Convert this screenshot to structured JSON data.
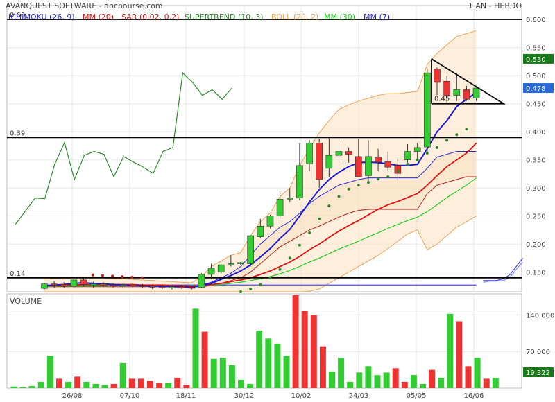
{
  "header": {
    "title": "AVANQUEST SOFTWARE - abcbourse.com",
    "period": "1 AN - HEBDO"
  },
  "legend": [
    {
      "label": "ICHIMOKU (26, 9)",
      "color": "#1f1fd0"
    },
    {
      "label": "MM (20)",
      "color": "#e01010"
    },
    {
      "label": "SAR (0.02, 0.2)",
      "color": "#c02020"
    },
    {
      "label": "SUPERTREND (10, 3)",
      "color": "#2a8a2a"
    },
    {
      "label": "BOLL (20, 2)",
      "color": "#f0a050"
    },
    {
      "label": "MM (30)",
      "color": "#22cc22"
    },
    {
      "label": "MM (7)",
      "color": "#2020e0"
    }
  ],
  "colors": {
    "up": "#33cc33",
    "down": "#ee3333",
    "ichimoku": "#1f1fd0",
    "mm20": "#e01010",
    "sar": "#c02020",
    "supertrend": "#2a8a2a",
    "boll": "#f0a050",
    "mm30": "#22cc22",
    "mm7": "#1818d8"
  },
  "chart_data": [
    {
      "type": "candlestick",
      "name": "price",
      "x_ticks": [
        "26/08",
        "07/10",
        "18/11",
        "30/12",
        "10/02",
        "24/03",
        "05/05",
        "16/06"
      ],
      "y_ticks": [
        "0.600",
        "0.550",
        "0.500",
        "0.450",
        "0.400",
        "0.350",
        "0.300",
        "0.250",
        "0.200",
        "0.150"
      ],
      "ylim": [
        0.115,
        0.625
      ],
      "price_tags": [
        {
          "value": 0.53,
          "label": "0.530",
          "bg": "#1a7a1a"
        },
        {
          "value": 0.478,
          "label": "0.478",
          "bg": "#2a6ad8"
        }
      ],
      "levels": [
        {
          "value": 0.6,
          "label": "0.60"
        },
        {
          "value": 0.39,
          "label": "0.39"
        },
        {
          "value": 0.14,
          "label": "0.14"
        }
      ],
      "triangle": {
        "label": "0.45",
        "apex": 0.53,
        "base": 0.45
      },
      "candles": [
        {
          "o": 0.121,
          "h": 0.131,
          "l": 0.119,
          "c": 0.129
        },
        {
          "o": 0.129,
          "h": 0.134,
          "l": 0.121,
          "c": 0.128
        },
        {
          "o": 0.128,
          "h": 0.132,
          "l": 0.122,
          "c": 0.125
        },
        {
          "o": 0.125,
          "h": 0.139,
          "l": 0.122,
          "c": 0.136
        },
        {
          "o": 0.136,
          "h": 0.139,
          "l": 0.125,
          "c": 0.128
        },
        {
          "o": 0.128,
          "h": 0.133,
          "l": 0.122,
          "c": 0.129
        },
        {
          "o": 0.129,
          "h": 0.132,
          "l": 0.124,
          "c": 0.127
        },
        {
          "o": 0.127,
          "h": 0.13,
          "l": 0.122,
          "c": 0.126
        },
        {
          "o": 0.126,
          "h": 0.129,
          "l": 0.121,
          "c": 0.127
        },
        {
          "o": 0.127,
          "h": 0.13,
          "l": 0.122,
          "c": 0.126
        },
        {
          "o": 0.126,
          "h": 0.129,
          "l": 0.121,
          "c": 0.125
        },
        {
          "o": 0.125,
          "h": 0.128,
          "l": 0.12,
          "c": 0.124
        },
        {
          "o": 0.124,
          "h": 0.128,
          "l": 0.12,
          "c": 0.123
        },
        {
          "o": 0.123,
          "h": 0.127,
          "l": 0.119,
          "c": 0.124
        },
        {
          "o": 0.124,
          "h": 0.127,
          "l": 0.12,
          "c": 0.123
        },
        {
          "o": 0.123,
          "h": 0.126,
          "l": 0.119,
          "c": 0.122
        },
        {
          "o": 0.123,
          "h": 0.148,
          "l": 0.121,
          "c": 0.146
        },
        {
          "o": 0.146,
          "h": 0.165,
          "l": 0.14,
          "c": 0.157
        },
        {
          "o": 0.15,
          "h": 0.165,
          "l": 0.148,
          "c": 0.163
        },
        {
          "o": 0.163,
          "h": 0.18,
          "l": 0.16,
          "c": 0.165
        },
        {
          "o": 0.165,
          "h": 0.168,
          "l": 0.163,
          "c": 0.167
        },
        {
          "o": 0.165,
          "h": 0.215,
          "l": 0.16,
          "c": 0.215
        },
        {
          "o": 0.213,
          "h": 0.245,
          "l": 0.21,
          "c": 0.232
        },
        {
          "o": 0.232,
          "h": 0.252,
          "l": 0.228,
          "c": 0.25
        },
        {
          "o": 0.25,
          "h": 0.295,
          "l": 0.245,
          "c": 0.28
        },
        {
          "o": 0.28,
          "h": 0.3,
          "l": 0.275,
          "c": 0.282
        },
        {
          "o": 0.282,
          "h": 0.38,
          "l": 0.278,
          "c": 0.34
        },
        {
          "o": 0.343,
          "h": 0.385,
          "l": 0.33,
          "c": 0.38
        },
        {
          "o": 0.38,
          "h": 0.388,
          "l": 0.3,
          "c": 0.315
        },
        {
          "o": 0.335,
          "h": 0.39,
          "l": 0.32,
          "c": 0.358
        },
        {
          "o": 0.358,
          "h": 0.38,
          "l": 0.345,
          "c": 0.365
        },
        {
          "o": 0.365,
          "h": 0.372,
          "l": 0.345,
          "c": 0.36
        },
        {
          "o": 0.356,
          "h": 0.388,
          "l": 0.33,
          "c": 0.32
        },
        {
          "o": 0.322,
          "h": 0.385,
          "l": 0.31,
          "c": 0.356
        },
        {
          "o": 0.355,
          "h": 0.37,
          "l": 0.33,
          "c": 0.346
        },
        {
          "o": 0.347,
          "h": 0.365,
          "l": 0.33,
          "c": 0.337
        },
        {
          "o": 0.34,
          "h": 0.355,
          "l": 0.312,
          "c": 0.326
        },
        {
          "o": 0.35,
          "h": 0.378,
          "l": 0.345,
          "c": 0.365
        },
        {
          "o": 0.365,
          "h": 0.38,
          "l": 0.352,
          "c": 0.372
        },
        {
          "o": 0.373,
          "h": 0.512,
          "l": 0.36,
          "c": 0.505
        },
        {
          "o": 0.512,
          "h": 0.515,
          "l": 0.465,
          "c": 0.488
        },
        {
          "o": 0.49,
          "h": 0.5,
          "l": 0.452,
          "c": 0.465
        },
        {
          "o": 0.465,
          "h": 0.505,
          "l": 0.455,
          "c": 0.475
        },
        {
          "o": 0.475,
          "h": 0.482,
          "l": 0.455,
          "c": 0.458
        },
        {
          "o": 0.46,
          "h": 0.482,
          "l": 0.455,
          "c": 0.478
        }
      ],
      "boll_upper": [
        0.138,
        0.139,
        0.139,
        0.14,
        0.141,
        0.141,
        0.14,
        0.139,
        0.138,
        0.137,
        0.136,
        0.135,
        0.134,
        0.133,
        0.132,
        0.131,
        0.142,
        0.16,
        0.17,
        0.18,
        0.185,
        0.215,
        0.24,
        0.255,
        0.285,
        0.3,
        0.34,
        0.37,
        0.398,
        0.42,
        0.44,
        0.448,
        0.455,
        0.46,
        0.465,
        0.468,
        0.468,
        0.47,
        0.472,
        0.52,
        0.54,
        0.555,
        0.57,
        0.575,
        0.58
      ],
      "boll_lower": [
        0.115,
        0.115,
        0.115,
        0.115,
        0.115,
        0.115,
        0.115,
        0.115,
        0.115,
        0.115,
        0.115,
        0.115,
        0.115,
        0.115,
        0.115,
        0.115,
        0.115,
        0.115,
        0.115,
        0.115,
        0.115,
        0.115,
        0.115,
        0.115,
        0.115,
        0.115,
        0.115,
        0.116,
        0.12,
        0.13,
        0.14,
        0.15,
        0.16,
        0.17,
        0.18,
        0.192,
        0.205,
        0.218,
        0.225,
        0.19,
        0.2,
        0.215,
        0.23,
        0.24,
        0.25
      ],
      "mm20": [
        0.126,
        0.126,
        0.127,
        0.127,
        0.128,
        0.128,
        0.128,
        0.128,
        0.128,
        0.128,
        0.127,
        0.127,
        0.127,
        0.126,
        0.126,
        0.125,
        0.126,
        0.128,
        0.13,
        0.133,
        0.136,
        0.14,
        0.146,
        0.152,
        0.16,
        0.168,
        0.178,
        0.19,
        0.2,
        0.212,
        0.223,
        0.233,
        0.242,
        0.252,
        0.262,
        0.27,
        0.276,
        0.283,
        0.29,
        0.305,
        0.322,
        0.338,
        0.35,
        0.362,
        0.38
      ],
      "mm30": [
        0.124,
        0.125,
        0.125,
        0.125,
        0.126,
        0.126,
        0.126,
        0.127,
        0.127,
        0.127,
        0.127,
        0.127,
        0.127,
        0.126,
        0.126,
        0.126,
        0.126,
        0.127,
        0.128,
        0.13,
        0.132,
        0.135,
        0.138,
        0.142,
        0.147,
        0.153,
        0.16,
        0.168,
        0.175,
        0.183,
        0.191,
        0.198,
        0.205,
        0.213,
        0.22,
        0.228,
        0.235,
        0.242,
        0.248,
        0.258,
        0.27,
        0.283,
        0.294,
        0.305,
        0.318
      ],
      "mm7": [
        0.126,
        0.127,
        0.128,
        0.13,
        0.131,
        0.13,
        0.129,
        0.128,
        0.127,
        0.126,
        0.126,
        0.125,
        0.125,
        0.124,
        0.124,
        0.123,
        0.126,
        0.13,
        0.137,
        0.144,
        0.152,
        0.163,
        0.177,
        0.192,
        0.21,
        0.226,
        0.25,
        0.275,
        0.297,
        0.315,
        0.328,
        0.338,
        0.345,
        0.346,
        0.345,
        0.343,
        0.34,
        0.34,
        0.342,
        0.37,
        0.4,
        0.42,
        0.445,
        0.458,
        0.47
      ],
      "ichi_a": [
        0.127,
        0.127,
        0.127,
        0.127,
        0.127,
        0.127,
        0.127,
        0.127,
        0.127,
        0.127,
        0.127,
        0.127,
        0.127,
        0.127,
        0.127,
        0.127,
        0.127,
        0.132,
        0.14,
        0.148,
        0.16,
        0.18,
        0.2,
        0.215,
        0.23,
        0.24,
        0.255,
        0.272,
        0.285,
        0.295,
        0.305,
        0.31,
        0.315,
        0.318,
        0.318,
        0.318,
        0.318,
        0.318,
        0.318,
        0.335,
        0.355,
        0.36,
        0.365,
        0.365,
        0.365
      ],
      "ichi_b": [
        0.124,
        0.124,
        0.124,
        0.124,
        0.124,
        0.124,
        0.124,
        0.124,
        0.124,
        0.124,
        0.124,
        0.124,
        0.124,
        0.124,
        0.124,
        0.124,
        0.124,
        0.126,
        0.13,
        0.135,
        0.14,
        0.15,
        0.165,
        0.18,
        0.195,
        0.205,
        0.215,
        0.225,
        0.232,
        0.24,
        0.248,
        0.255,
        0.26,
        0.262,
        0.262,
        0.262,
        0.262,
        0.262,
        0.262,
        0.29,
        0.305,
        0.31,
        0.315,
        0.32,
        0.32
      ],
      "kumo_future": [
        0.135,
        0.135,
        0.135,
        0.138,
        0.145,
        0.16,
        0.175
      ],
      "kumo_future_low": [
        0.132,
        0.134,
        0.134,
        0.135,
        0.14,
        0.155,
        0.168
      ],
      "kumo_base_line": [
        0.125,
        0.125,
        0.125,
        0.127,
        0.127,
        0.127,
        0.127,
        0.127,
        0.127,
        0.127,
        0.127,
        0.127,
        0.127,
        0.127,
        0.127,
        0.127,
        0.127,
        0.127,
        0.127,
        0.127,
        0.127,
        0.127,
        0.127,
        0.127,
        0.127,
        0.127,
        0.127,
        0.127,
        0.127,
        0.127,
        0.127,
        0.127,
        0.127,
        0.127,
        0.127,
        0.127,
        0.127,
        0.127,
        0.127,
        0.127,
        0.127,
        0.127,
        0.127,
        0.127,
        0.127
      ],
      "sar_red": [
        0.145,
        0.144,
        0.143,
        0.142,
        0.141,
        0.14
      ],
      "sar_red_idx": [
        12,
        13,
        14,
        15,
        16,
        17
      ],
      "sar_green": [
        0.115,
        0.12,
        0.128,
        0.14,
        0.155,
        0.175,
        0.198,
        0.22,
        0.245,
        0.268,
        0.285,
        0.298,
        0.305,
        0.31,
        0.316,
        0.32,
        0.33,
        0.342,
        0.35,
        0.362,
        0.372,
        0.385,
        0.395,
        0.405
      ],
      "sar_green_idx": [
        20,
        21,
        22,
        23,
        24,
        25,
        26,
        27,
        28,
        29,
        30,
        31,
        32,
        33,
        34,
        35,
        36,
        37,
        38,
        39,
        40,
        41,
        42,
        43
      ],
      "supertrend_ext": [
        0.135,
        0.21,
        0.235,
        0.275,
        0.28,
        0.28,
        0.32,
        0.355,
        0.38,
        0.395,
        0.395,
        0.39,
        0.39,
        0.4,
        0.43,
        0.43,
        0.435,
        0.44,
        0.48
      ],
      "supertrend_lagging": [
        0.235,
        0.258,
        0.282,
        0.281,
        0.342,
        0.381,
        0.315,
        0.358,
        0.365,
        0.36,
        0.32,
        0.356,
        0.346,
        0.337,
        0.326,
        0.365,
        0.372,
        0.505,
        0.488,
        0.465,
        0.475,
        0.458,
        0.478
      ],
      "lag_idx_start": 1
    },
    {
      "type": "bar",
      "name": "volume",
      "label": "VOLUME",
      "y_ticks": [
        "140 000",
        "70 000"
      ],
      "ylim": [
        0,
        175000
      ],
      "last_tag": "19 322",
      "values": [
        3000,
        2000,
        4000,
        12000,
        62000,
        18000,
        12000,
        22000,
        12000,
        8000,
        6000,
        8000,
        48000,
        18000,
        18000,
        14000,
        10000,
        10000,
        20000,
        6000,
        152000,
        108000,
        56000,
        58000,
        44000,
        16000,
        8000,
        110000,
        95000,
        85000,
        62000,
        178000,
        148000,
        140000,
        80000,
        32000,
        58000,
        12000,
        30000,
        42000,
        25000,
        30000,
        38000,
        12000,
        25000,
        8000,
        35000,
        20000,
        142000,
        128000,
        42000,
        58000,
        18000,
        19322
      ],
      "up": [
        true,
        true,
        true,
        true,
        true,
        false,
        true,
        false,
        true,
        true,
        true,
        false,
        true,
        false,
        false,
        false,
        false,
        true,
        false,
        false,
        true,
        false,
        true,
        true,
        true,
        true,
        true,
        true,
        true,
        true,
        true,
        false,
        false,
        false,
        false,
        true,
        true,
        true,
        true,
        true,
        true,
        true,
        false,
        false,
        true,
        true,
        false,
        true,
        true,
        false,
        false,
        true,
        false,
        true
      ]
    }
  ]
}
